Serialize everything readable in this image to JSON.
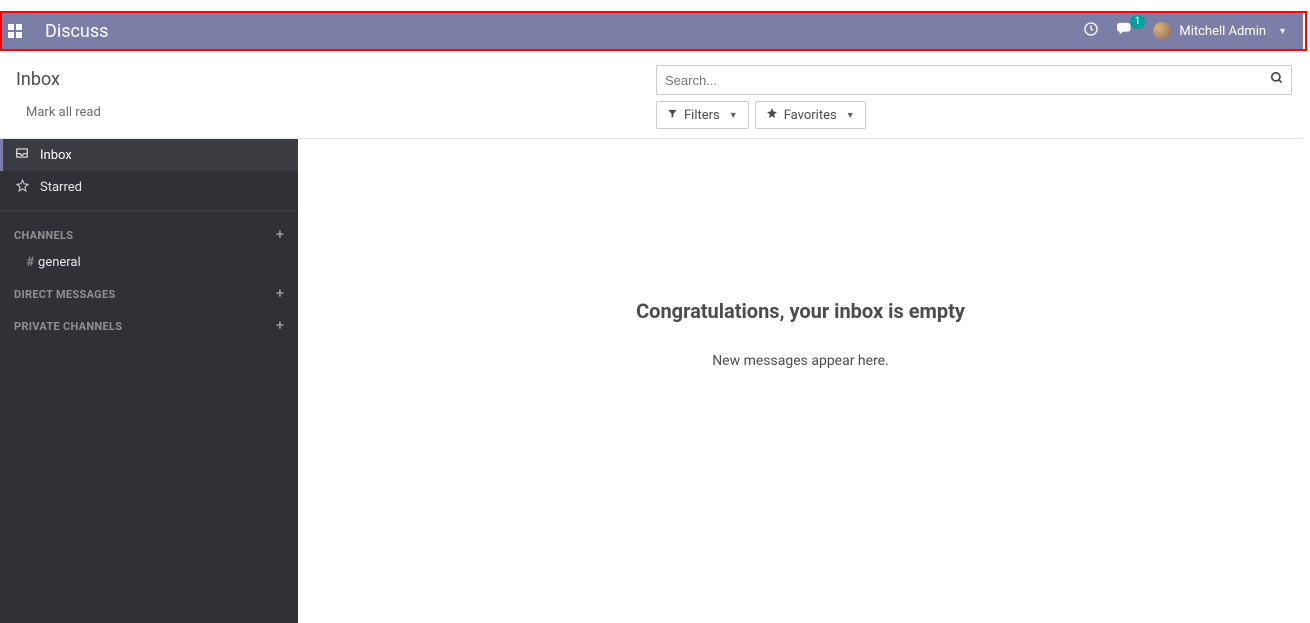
{
  "header": {
    "app_title": "Discuss",
    "user_name": "Mitchell Admin",
    "messages_badge": "1"
  },
  "control": {
    "page_title": "Inbox",
    "mark_all_label": "Mark all read",
    "search_placeholder": "Search...",
    "filters_label": "Filters",
    "favorites_label": "Favorites"
  },
  "sidebar": {
    "inbox_label": "Inbox",
    "starred_label": "Starred",
    "channels_header": "CHANNELS",
    "channels": [
      {
        "name": "general"
      }
    ],
    "dm_header": "DIRECT MESSAGES",
    "private_header": "PRIVATE CHANNELS"
  },
  "empty": {
    "title": "Congratulations, your inbox is empty",
    "subtitle": "New messages appear here."
  }
}
